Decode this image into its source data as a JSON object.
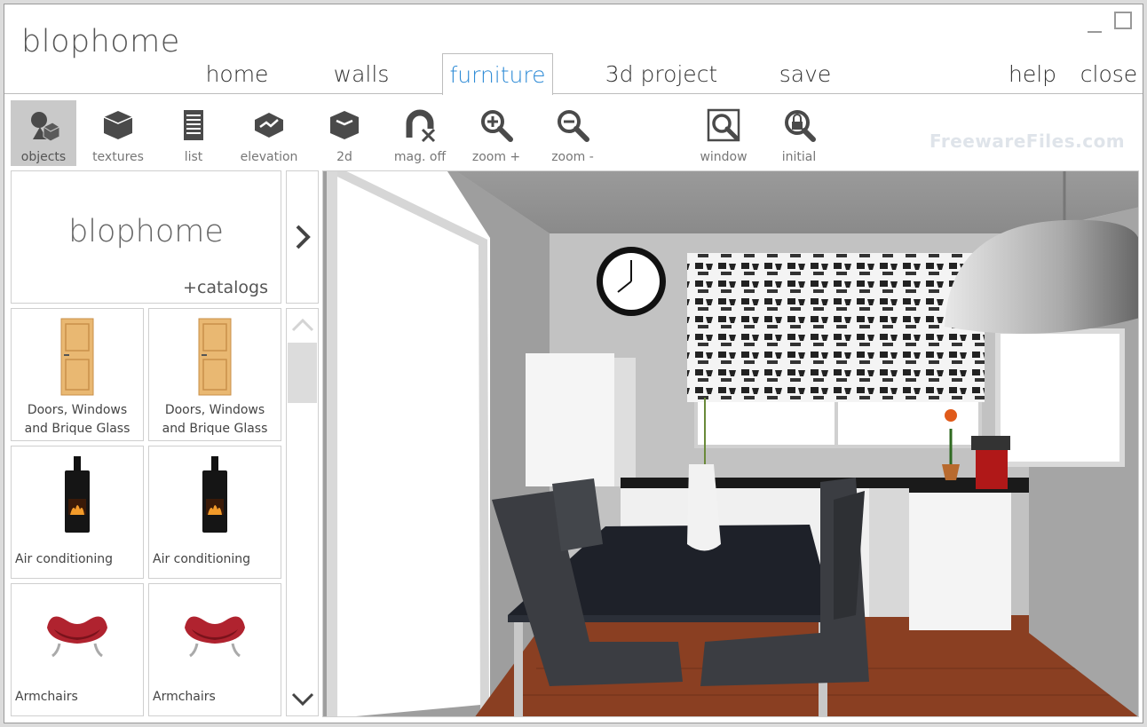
{
  "app": {
    "title": "blophome"
  },
  "menu": {
    "home": "home",
    "walls": "walls",
    "furniture": "furniture",
    "project3d": "3d project",
    "save": "save",
    "help": "help",
    "close": "close",
    "active": "furniture"
  },
  "toolbar": {
    "objects": "objects",
    "textures": "textures",
    "list": "list",
    "elevation": "elevation",
    "view2d": "2d",
    "mag_off": "mag. off",
    "zoom_in": "zoom +",
    "zoom_out": "zoom -",
    "window": "window",
    "initial": "initial"
  },
  "watermark": "FreewareFiles.com",
  "catalog": {
    "title": "blophome",
    "link": "+catalogs",
    "items": [
      {
        "line1": "Doors, Windows",
        "line2": "and Brique Glass",
        "icon": "door-icon"
      },
      {
        "line1": "Doors, Windows",
        "line2": "and Brique Glass",
        "icon": "door-icon"
      },
      {
        "line1": "Air conditioning",
        "icon": "stove-icon"
      },
      {
        "line1": "Air conditioning",
        "icon": "stove-icon"
      },
      {
        "line1": "Armchairs",
        "icon": "armchair-icon"
      },
      {
        "line1": "Armchairs",
        "icon": "armchair-icon"
      }
    ]
  },
  "colors": {
    "accent": "#2e8bd6",
    "active_tool_bg": "#c9c9c9",
    "floor": "#8a3f22",
    "table": "#1e2129"
  }
}
